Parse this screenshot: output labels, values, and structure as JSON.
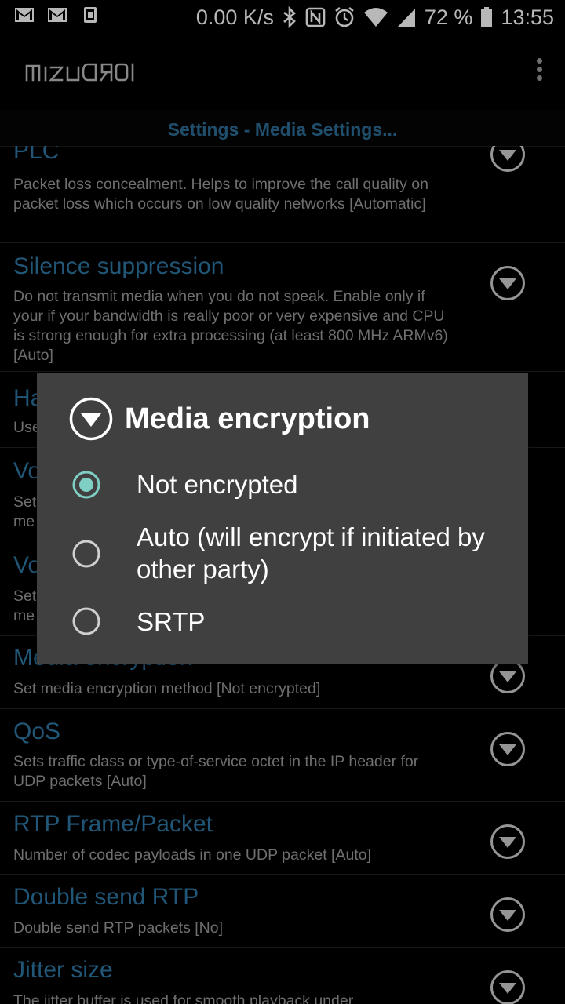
{
  "status_bar": {
    "left_icons": [
      "gmail-icon",
      "gmail-icon",
      "sim-card-icon"
    ],
    "net_speed": "0.00 K/s",
    "battery": "72 %",
    "time": "13:55",
    "right_icons": [
      "bluetooth-icon",
      "nfc-icon",
      "alarm-icon",
      "wifi-icon",
      "signal-icon",
      "battery-icon"
    ]
  },
  "app_bar": {
    "logo": "mizuDroid",
    "menu_icon": "overflow-menu-icon"
  },
  "section_header": "Settings - Media Settings...",
  "preferences": [
    {
      "title": "PLC",
      "summary": "Packet loss concealment. Helps to improve the call quality on packet loss which occurs on low quality networks [Automatic]"
    },
    {
      "title": "Silence suppression",
      "summary": "Do not transmit media when you do not speak. Enable only if your if your bandwidth is really poor or very expensive and CPU is strong enough for extra processing (at least 800 MHz ARMv6) [Auto]"
    },
    {
      "title": "Ha",
      "summary": "Use"
    },
    {
      "title": "Vo",
      "summary": "Set me"
    },
    {
      "title": "Vo",
      "summary": "Set me"
    },
    {
      "title": "Media encryption",
      "summary": "Set media encryption method [Not encrypted]"
    },
    {
      "title": "QoS",
      "summary": "Sets traffic class or type-of-service octet in the IP header for UDP packets [Auto]"
    },
    {
      "title": "RTP Frame/Packet",
      "summary": "Number of codec payloads in one UDP packet [Auto]"
    },
    {
      "title": "Double send RTP",
      "summary": "Double send RTP packets [No]"
    },
    {
      "title": "Jitter size",
      "summary": "The jitter buffer is used for smooth playback under"
    }
  ],
  "dialog": {
    "title": "Media encryption",
    "options": [
      {
        "label": "Not encrypted",
        "selected": true
      },
      {
        "label": "Auto (will encrypt if initiated by other party)",
        "selected": false
      },
      {
        "label": "SRTP",
        "selected": false
      }
    ]
  },
  "colors": {
    "accent_teal": "#7fcfc4",
    "pref_title_blue": "#2f78a6",
    "header_blue": "#2c6e97",
    "dialog_bg": "#404040"
  }
}
